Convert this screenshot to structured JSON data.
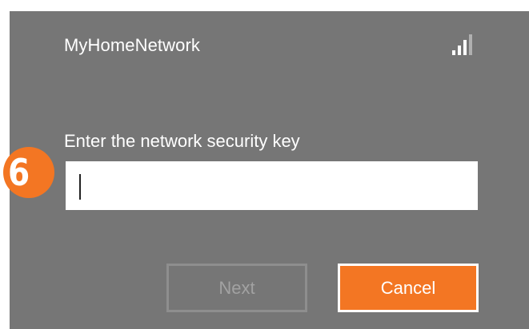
{
  "network": {
    "name": "MyHomeNetwork",
    "signal_icon": "wifi-signal-bars-icon",
    "signal_bars_active": 3,
    "signal_bars_total": 4
  },
  "prompt": {
    "label": "Enter the network security key",
    "input_value": ""
  },
  "step": {
    "number": "6",
    "badge_color": "#f37623"
  },
  "buttons": {
    "next_label": "Next",
    "cancel_label": "Cancel"
  },
  "colors": {
    "panel": "#767676",
    "accent": "#f37623",
    "disabled": "#a2a2a2"
  }
}
